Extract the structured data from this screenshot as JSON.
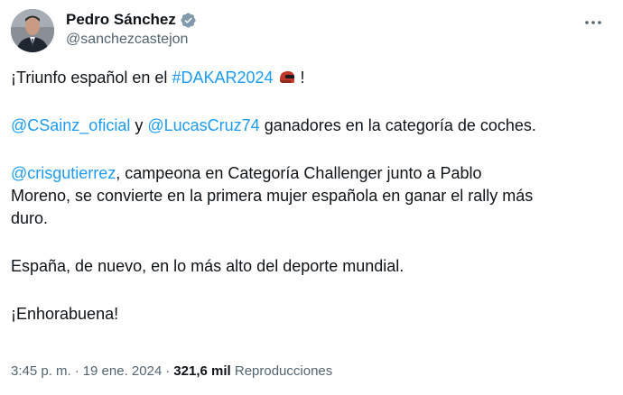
{
  "author": {
    "display_name": "Pedro Sánchez",
    "handle": "@sanchezcastejon"
  },
  "icons": {
    "verified": "verified-badge-icon",
    "more": "more-dots-icon",
    "helmet": "racing-helmet-emoji"
  },
  "colors": {
    "link": "#1d9bf0",
    "text": "#0f1419",
    "muted": "#536471"
  },
  "tweet": {
    "line1_prefix": "¡Triunfo español en el ",
    "line1_hashtag": "#DAKAR2024",
    "line1_suffix": " !",
    "mention1": "@CSainz_oficial",
    "conj": " y ",
    "mention2": "@LucasCruz74",
    "line2_suffix": " ganadores en la categoría de coches.",
    "mention3": "@crisgutierrez",
    "line3_suffix": ", campeona en Categoría Challenger junto a Pablo",
    "line3b": "Moreno, se convierte en la primera mujer española en ganar el rally más",
    "line3c": "duro.",
    "line4": "España, de nuevo, en lo más alto del deporte mundial.",
    "line5": "¡Enhorabuena!"
  },
  "meta": {
    "time": "3:45 p. m.",
    "separator1": "·",
    "date": "19 ene. 2024",
    "separator2": "·",
    "views_count": "321,6 mil",
    "views_label": "Reproducciones"
  }
}
